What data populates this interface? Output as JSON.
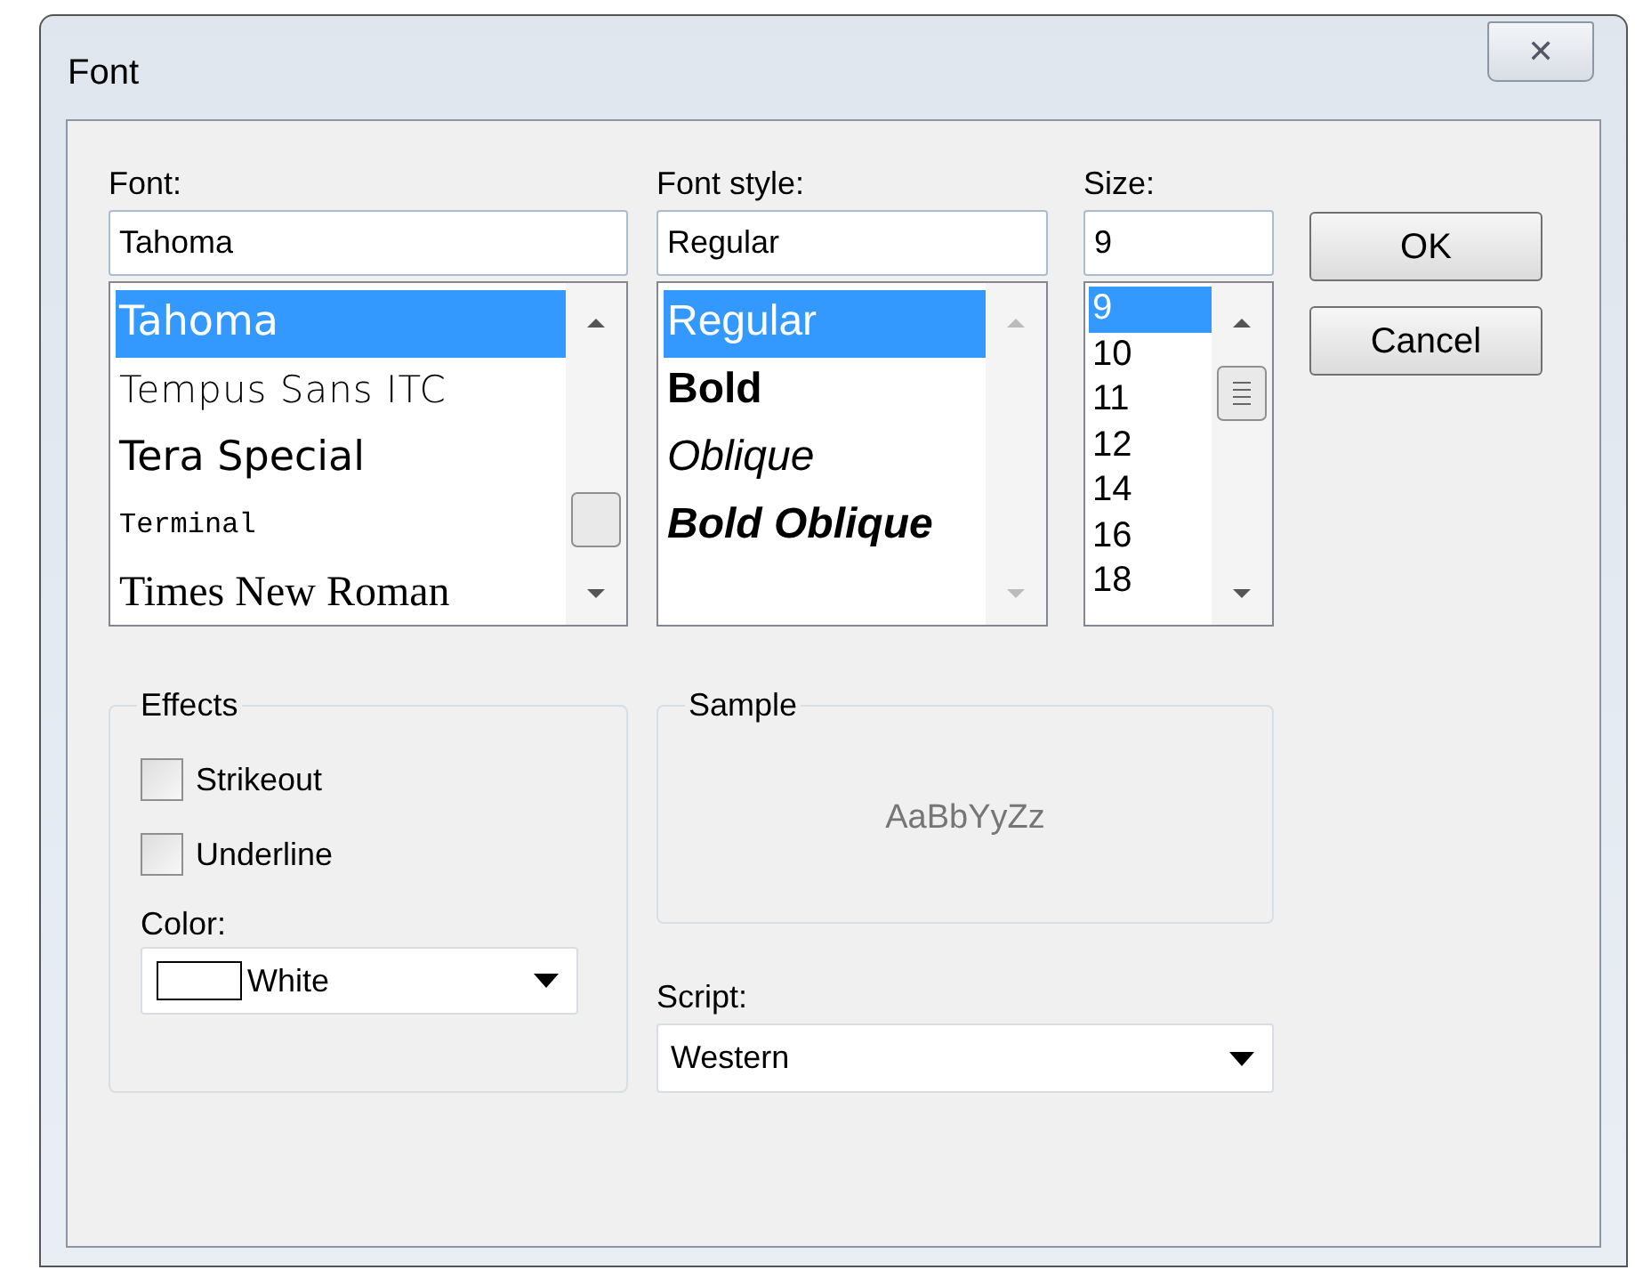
{
  "window": {
    "title": "Font",
    "close": "✕"
  },
  "font": {
    "label": "Font:",
    "value": "Tahoma",
    "items": [
      {
        "label": "Tahoma",
        "selected": true
      },
      {
        "label": "Tempus Sans ITC",
        "selected": false
      },
      {
        "label": "Tera Special",
        "selected": false
      },
      {
        "label": "Terminal",
        "selected": false
      },
      {
        "label": "Times New Roman",
        "selected": false
      }
    ]
  },
  "font_style": {
    "label": "Font style:",
    "value": "Regular",
    "items": [
      {
        "label": "Regular",
        "selected": true
      },
      {
        "label": "Bold",
        "selected": false
      },
      {
        "label": "Oblique",
        "selected": false
      },
      {
        "label": "Bold Oblique",
        "selected": false
      }
    ]
  },
  "size": {
    "label": "Size:",
    "value": "9",
    "items": [
      {
        "label": "9",
        "selected": true
      },
      {
        "label": "10",
        "selected": false
      },
      {
        "label": "11",
        "selected": false
      },
      {
        "label": "12",
        "selected": false
      },
      {
        "label": "14",
        "selected": false
      },
      {
        "label": "16",
        "selected": false
      },
      {
        "label": "18",
        "selected": false
      }
    ]
  },
  "buttons": [
    "OK",
    "Cancel"
  ],
  "effects": {
    "title": "Effects",
    "checkboxes": [
      {
        "label": "Strikeout",
        "checked": false
      },
      {
        "label": "Underline",
        "checked": false
      }
    ],
    "color": {
      "label": "Color:",
      "value": "White",
      "color": "#ffffff"
    }
  },
  "sample": {
    "title": "Sample",
    "text": "AaBbYyZz"
  },
  "script": {
    "label": "Script:",
    "value": "Western"
  }
}
